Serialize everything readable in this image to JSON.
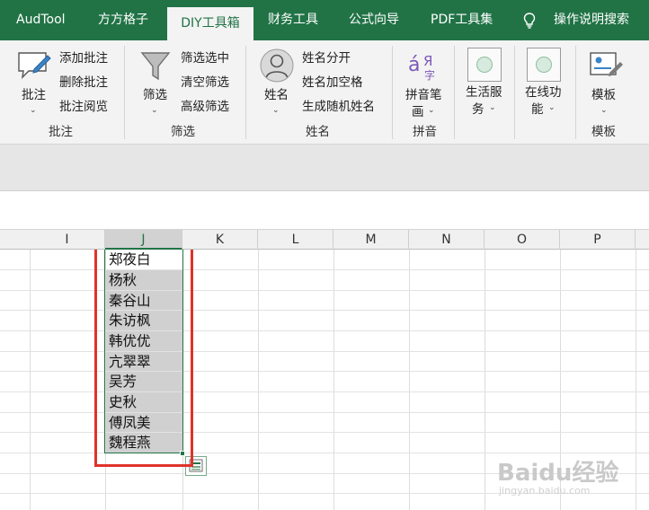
{
  "tabs": [
    {
      "label": "AudTool",
      "active": false
    },
    {
      "label": "方方格子",
      "active": false
    },
    {
      "label": "DIY工具箱",
      "active": true
    },
    {
      "label": "财务工具",
      "active": false
    },
    {
      "label": "公式向导",
      "active": false
    },
    {
      "label": "PDF工具集",
      "active": false
    }
  ],
  "search_label": "操作说明搜索",
  "ribbon": {
    "annotation": {
      "main_label": "批注",
      "items": [
        "添加批注",
        "删除批注",
        "批注阅览"
      ],
      "group": "批注"
    },
    "filter": {
      "main_label": "筛选",
      "items": [
        "筛选选中",
        "清空筛选",
        "高级筛选"
      ],
      "group": "筛选"
    },
    "name": {
      "main_label": "姓名",
      "items": [
        "姓名分开",
        "姓名加空格",
        "生成随机姓名"
      ],
      "group": "姓名"
    },
    "pinyin": {
      "btn_line1": "拼音笔",
      "btn_line2": "画",
      "group": "拼音"
    },
    "life": {
      "line1": "生活服",
      "line2": "务"
    },
    "online": {
      "line1": "在线功",
      "line2": "能"
    },
    "template": {
      "label": "模板",
      "group": "模板"
    }
  },
  "columns": [
    "I",
    "J",
    "K",
    "L",
    "M",
    "N",
    "O",
    "P"
  ],
  "selected_column": "J",
  "cells": [
    "郑夜白",
    "杨秋",
    "秦谷山",
    "朱访枫",
    "韩优优",
    "亢翠翠",
    "吴芳",
    "史秋",
    "傅凤美",
    "魏程燕"
  ],
  "watermark": {
    "main": "Baidu经验",
    "sub": "jingyan.baidu.com"
  },
  "colors": {
    "excel_green": "#217346",
    "highlight_red": "#e0322a",
    "selection_gray": "#d0d0d0"
  }
}
